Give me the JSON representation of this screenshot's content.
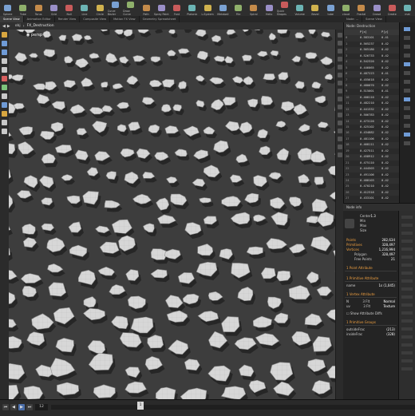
{
  "shelf": {
    "tools": [
      "Sphere",
      "Tube",
      "Torus",
      "Grid",
      "Null",
      "Line",
      "Circle",
      "Curve Bezier",
      "Draw Curve",
      "Path",
      "Spray Paint",
      "Font",
      "Platonic",
      "L-System",
      "Metaball",
      "File",
      "Spiral",
      "Helix",
      "Quick Shapes",
      "Volume",
      "Bevel",
      "tube",
      "cloud",
      "Fractal",
      "Crowd",
      "Create",
      "mat"
    ]
  },
  "tabs": [
    "Scene View",
    "Animation Editor",
    "Render View",
    "Composite View",
    "Motion FX View",
    "Geometry Spreadsheet"
  ],
  "tabs_right": [
    "Node: ...",
    "Scene View"
  ],
  "path": {
    "obj": "obj",
    "node": "FX_Destruction"
  },
  "spreadsheet": {
    "title": "Node: Destruction",
    "columns": [
      "",
      "P[x]",
      "P[y]"
    ],
    "rows": [
      [
        "0",
        "0.583101",
        "0.41"
      ],
      [
        "1",
        "0.565237",
        "0.42"
      ],
      [
        "2",
        "0.565180",
        "0.42"
      ],
      [
        "3",
        "0.526733",
        "0.42"
      ],
      [
        "4",
        "0.542320",
        "0.42"
      ],
      [
        "5",
        "0.446065",
        "0.42"
      ],
      [
        "6",
        "0.487223",
        "0.41"
      ],
      [
        "7",
        "0.455618",
        "0.42"
      ],
      [
        "8",
        "0.480070",
        "0.42"
      ],
      [
        "9",
        "0.515001",
        "0.41"
      ],
      [
        "10",
        "0.408110",
        "0.42"
      ],
      [
        "11",
        "0.482210",
        "0.42"
      ],
      [
        "12",
        "0.441332",
        "0.42"
      ],
      [
        "13",
        "0.506783",
        "0.42"
      ],
      [
        "14",
        "0.473120",
        "0.42"
      ],
      [
        "15",
        "0.425102",
        "0.42"
      ],
      [
        "16",
        "0.434882",
        "0.42"
      ],
      [
        "17",
        "0.481106",
        "0.42"
      ],
      [
        "18",
        "0.468111",
        "0.42"
      ],
      [
        "19",
        "0.427511",
        "0.42"
      ],
      [
        "20",
        "0.458912",
        "0.42"
      ],
      [
        "21",
        "0.475110",
        "0.42"
      ],
      [
        "22",
        "0.444503",
        "0.42"
      ],
      [
        "23",
        "0.491106",
        "0.42"
      ],
      [
        "24",
        "0.488103",
        "0.42"
      ],
      [
        "25",
        "0.470210",
        "0.42"
      ],
      [
        "26",
        "0.412318",
        "0.42"
      ],
      [
        "27",
        "0.433101",
        "0.42"
      ],
      [
        "28",
        "0.469150",
        "0.42"
      ]
    ]
  },
  "info": {
    "title": "Node info",
    "center_label": "Center",
    "center_x": "1.3",
    "min_label": "Min",
    "max_label": "Max",
    "size_label": "Size",
    "points_label": "Points",
    "points": "282,634",
    "primitives_label": "Primitives",
    "primitives": "328,497",
    "vertices_label": "Vertices",
    "vertices": "1,216,994",
    "polygon_label": "Polygon",
    "polygon": "328,497",
    "free_points_label": "Free Points",
    "free_points": "21",
    "point_attr": "1 Point Attribute",
    "prim_attr": "1 Primitive Attribute",
    "prim_attr_name": "name",
    "prim_attr_val": "1s (1,045)",
    "vertex_attr": "1 Vertex Attribute",
    "n_label": "N",
    "n_type": "3 Flt",
    "n_val": "Normal",
    "uv_label": "uv",
    "uv_type": "3 Flt",
    "uv_val": "Texture",
    "show_diffs": "Show Attribute Diffs",
    "prim_groups": "1 Primitive Groups",
    "grp1": "outsideFrac",
    "grp1_val": "(213)",
    "grp2": "insideFrac",
    "grp2_val": "(328)"
  },
  "timeline": {
    "frame": "12",
    "start": "1",
    "mark": "1"
  },
  "colors": {
    "accent": "#f0a040",
    "viewport": "#3d3d3d",
    "shard": "#d7d7d7",
    "shard_edge": "#8e8e8e"
  }
}
